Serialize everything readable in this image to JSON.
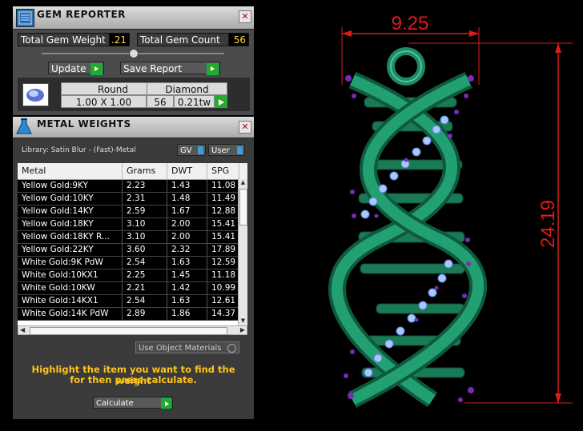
{
  "gem_reporter": {
    "title": "GEM REPORTER",
    "close": "✕",
    "total_weight_label": "Total Gem Weight",
    "total_weight_value": ".21",
    "total_count_label": "Total Gem Count",
    "total_count_value": "56",
    "update_label": "Update",
    "save_report_label": "Save Report",
    "table_headers": [
      "Round",
      "Diamond"
    ],
    "row": {
      "size": "1.00 X 1.00",
      "count": "56",
      "weight": "0.21tw"
    }
  },
  "metal_weights": {
    "title": "METAL WEIGHTS",
    "close": "✕",
    "library_label": "Library: Satin Blur - (Fast)-Metal",
    "gv_label": "GV",
    "user_label": "User",
    "columns": [
      "Metal",
      "Grams",
      "DWT",
      "SPG"
    ],
    "rows": [
      [
        "Yellow Gold:9KY",
        "2.23",
        "1.43",
        "11.08"
      ],
      [
        "Yellow Gold:10KY",
        "2.31",
        "1.48",
        "11.49"
      ],
      [
        "Yellow Gold:14KY",
        "2.59",
        "1.67",
        "12.88"
      ],
      [
        "Yellow Gold:18KY",
        "3.10",
        "2.00",
        "15.41"
      ],
      [
        "Yellow Gold:18KY R...",
        "3.10",
        "2.00",
        "15.41"
      ],
      [
        "Yellow Gold:22KY",
        "3.60",
        "2.32",
        "17.89"
      ],
      [
        "White Gold:9K PdW",
        "2.54",
        "1.63",
        "12.59"
      ],
      [
        "White Gold:10KX1",
        "2.25",
        "1.45",
        "11.18"
      ],
      [
        "White Gold:10KW",
        "2.21",
        "1.42",
        "10.99"
      ],
      [
        "White Gold:14KX1",
        "2.54",
        "1.63",
        "12.61"
      ],
      [
        "White Gold:14K PdW",
        "2.89",
        "1.86",
        "14.37"
      ]
    ],
    "use_object_materials": "Use Object Materials",
    "message_line1": "Highlight the item you want to find the weight",
    "message_line2": "for then press calculate.",
    "calculate_label": "Calculate"
  },
  "viewport": {
    "width_dimension": "9.25",
    "height_dimension": "24.19"
  },
  "colors": {
    "dimension": "#e11a1a",
    "metal": "#1e8a62",
    "gem": "#a6c8ff",
    "prong": "#7b2ab8"
  }
}
